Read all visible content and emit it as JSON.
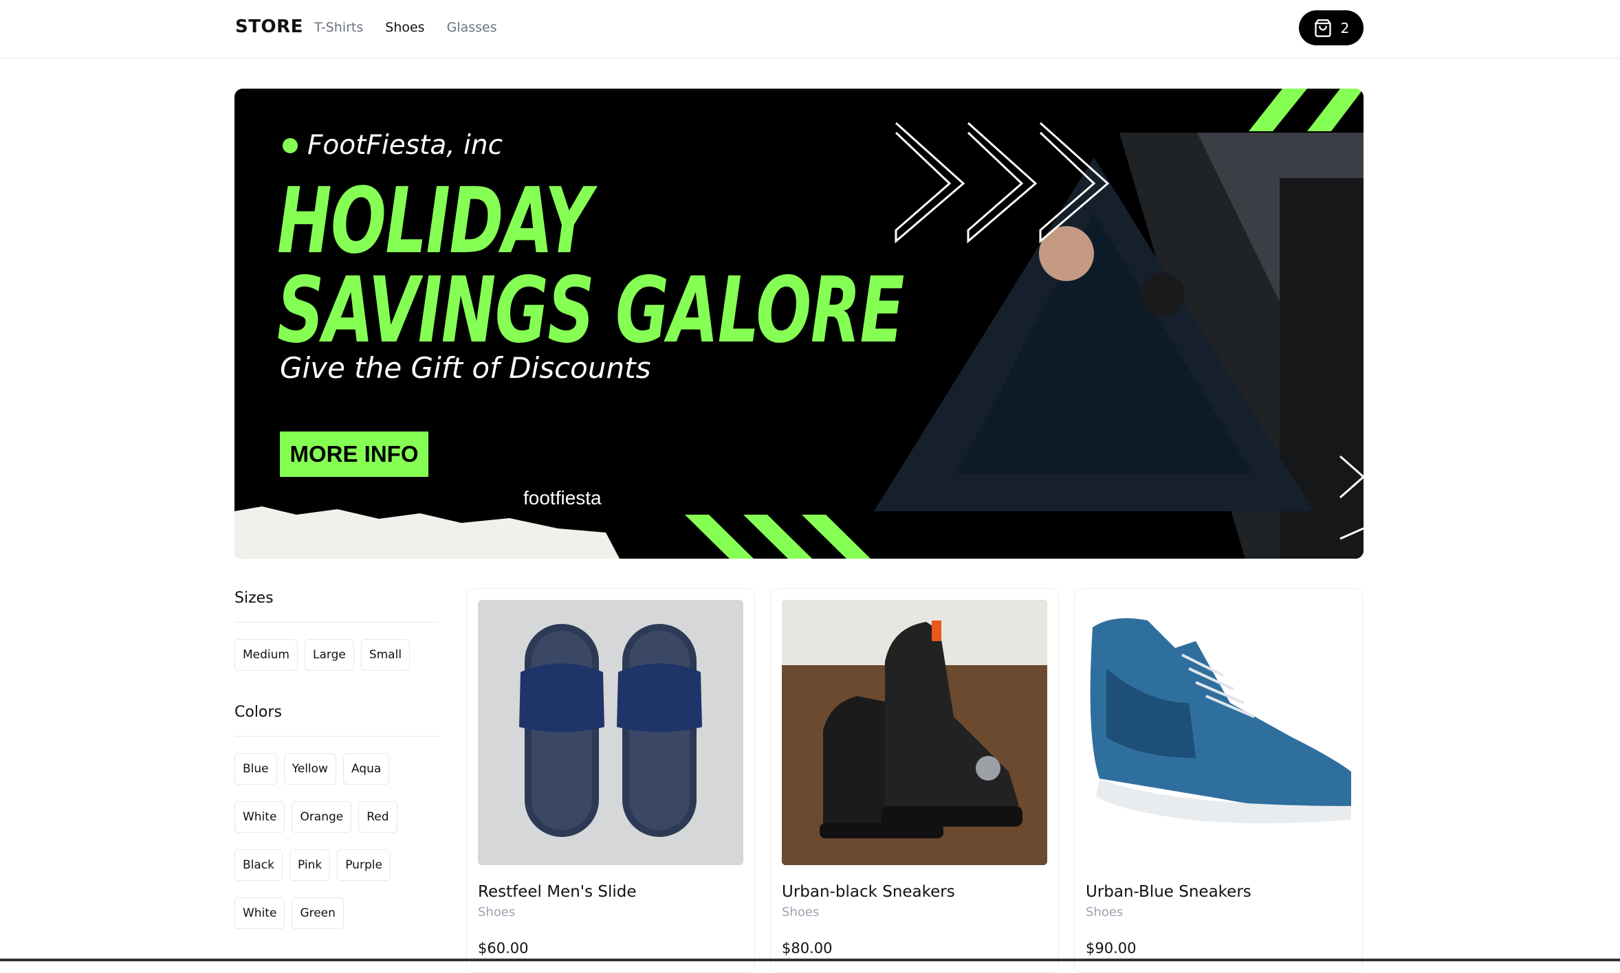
{
  "header": {
    "brand": "STORE",
    "nav": [
      {
        "label": "T-Shirts",
        "active": false
      },
      {
        "label": "Shoes",
        "active": true
      },
      {
        "label": "Glasses",
        "active": false
      }
    ],
    "cart_count": "2"
  },
  "banner": {
    "company": "FootFiesta, inc",
    "headline_line1": "HOLIDAY",
    "headline_line2": "SAVINGS GALORE",
    "tagline": "Give the Gift of Discounts",
    "button_label": "MORE INFO",
    "handle": "footfiesta",
    "accent_color": "#86ff55"
  },
  "filters": {
    "sizes_title": "Sizes",
    "sizes": [
      "Medium",
      "Large",
      "Small"
    ],
    "colors_title": "Colors",
    "colors": [
      "Blue",
      "Yellow",
      "Aqua",
      "White",
      "Orange",
      "Red",
      "Black",
      "Pink",
      "Purple",
      "White",
      "Green"
    ]
  },
  "products": [
    {
      "name": "Restfeel Men's Slide",
      "category": "Shoes",
      "price": "$60.00"
    },
    {
      "name": "Urban-black Sneakers",
      "category": "Shoes",
      "price": "$80.00"
    },
    {
      "name": "Urban-Blue Sneakers",
      "category": "Shoes",
      "price": "$90.00"
    }
  ]
}
